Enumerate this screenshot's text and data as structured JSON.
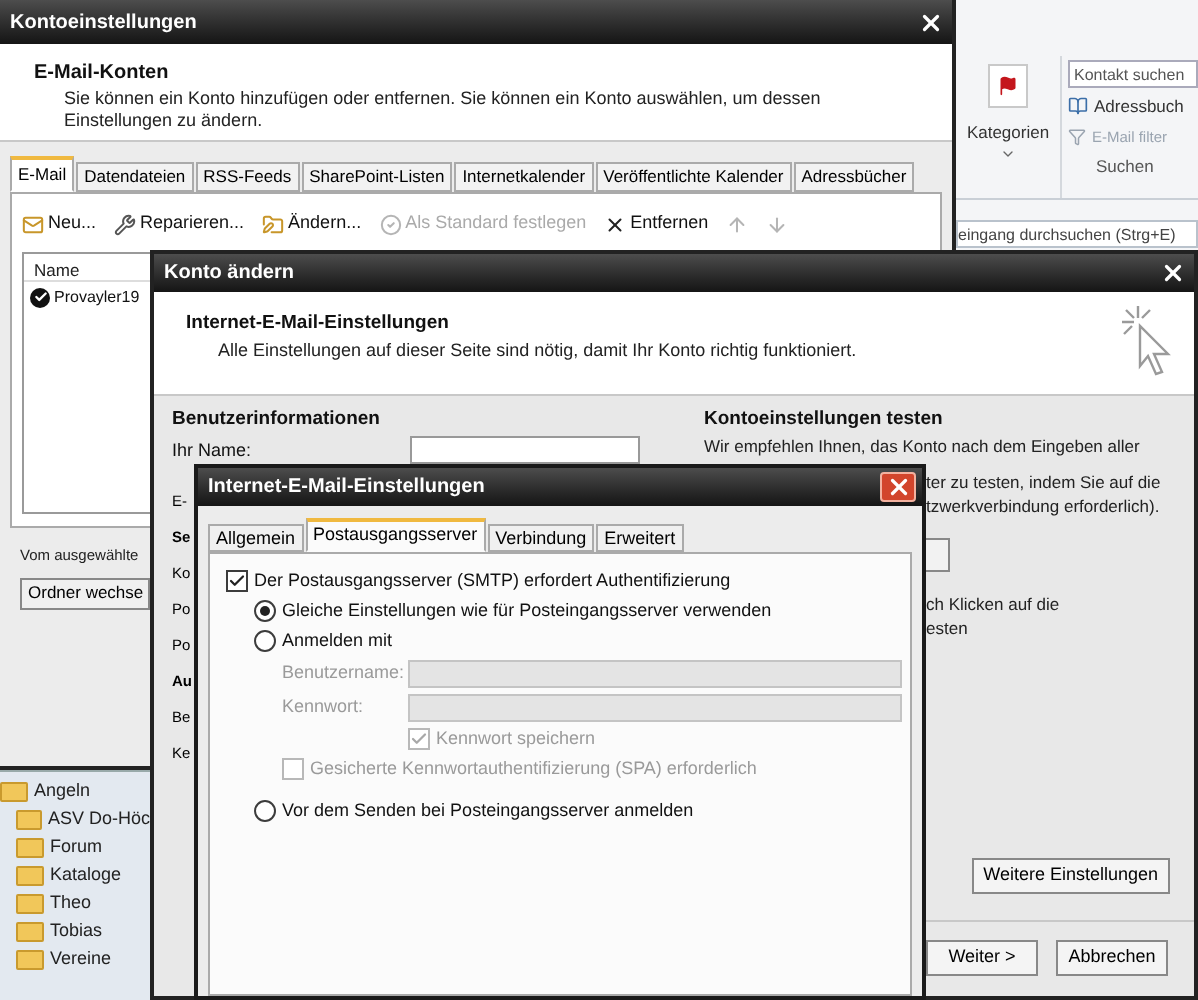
{
  "outlook": {
    "categories": {
      "label": "Kategorien"
    },
    "contact_search": {
      "placeholder": "Kontakt suchen"
    },
    "address_book": {
      "label": "Adressbuch",
      "disabled": false
    },
    "mail_filter": {
      "label": "E-Mail filter",
      "disabled": true
    },
    "group_label": "Suchen",
    "search_bar": {
      "placeholder": "eingang durchsuchen (Strg+E)"
    },
    "folders": [
      {
        "name": "Angeln",
        "children": [
          {
            "name": "ASV Do-Höc"
          },
          {
            "name": "Forum"
          },
          {
            "name": "Kataloge"
          },
          {
            "name": "Theo"
          },
          {
            "name": "Tobias"
          },
          {
            "name": "Vereine"
          }
        ]
      }
    ]
  },
  "account_settings": {
    "title": "Kontoeinstellungen",
    "heading": "E-Mail-Konten",
    "description": "Sie können ein Konto hinzufügen oder entfernen. Sie können ein Konto auswählen, um dessen Einstellungen zu ändern.",
    "tabs": [
      {
        "label": "E-Mail",
        "selected": true
      },
      {
        "label": "Datendateien",
        "selected": false
      },
      {
        "label": "RSS-Feeds",
        "selected": false
      },
      {
        "label": "SharePoint-Listen",
        "selected": false
      },
      {
        "label": "Internetkalender",
        "selected": false
      },
      {
        "label": "Veröffentlichte Kalender",
        "selected": false
      },
      {
        "label": "Adressbücher",
        "selected": false
      }
    ],
    "toolbar": [
      {
        "kind": "new",
        "label": "Neu...",
        "disabled": false
      },
      {
        "kind": "repair",
        "label": "Reparieren...",
        "disabled": false
      },
      {
        "kind": "change",
        "label": "Ändern...",
        "disabled": false
      },
      {
        "kind": "default",
        "label": "Als Standard festlegen",
        "disabled": true
      },
      {
        "kind": "remove",
        "label": "Entfernen",
        "disabled": false
      },
      {
        "kind": "up",
        "disabled": true
      },
      {
        "kind": "down",
        "disabled": true
      }
    ],
    "list": {
      "columns": [
        "Name"
      ],
      "rows": [
        {
          "name": "Provayler19",
          "default": true
        }
      ]
    },
    "folder_note": "Vom ausgewählte",
    "folder_button": "Ordner wechse"
  },
  "change_account": {
    "title": "Konto ändern",
    "heading": "Internet-E-Mail-Einstellungen",
    "description": "Alle Einstellungen auf dieser Seite sind nötig, damit Ihr Konto richtig funktioniert.",
    "user_heading": "Benutzerinformationen",
    "name_label": "Ihr Name:",
    "label_fragments": [
      {
        "kind": "label",
        "text": "E-"
      },
      {
        "kind": "heading",
        "text": "Se"
      },
      {
        "kind": "label",
        "text": "Ko"
      },
      {
        "kind": "label",
        "text": "Po"
      },
      {
        "kind": "label",
        "text": "Po"
      },
      {
        "kind": "heading",
        "text": "Au"
      },
      {
        "kind": "label",
        "text": "Be"
      },
      {
        "kind": "label",
        "text": "Ke"
      }
    ],
    "test_heading": "Kontoeinstellungen testen",
    "test_text": "Wir empfehlen Ihnen, das Konto nach dem Eingeben aller",
    "test_fragments": [
      {
        "kind": "text",
        "text": "ter zu testen, indem Sie auf die"
      },
      {
        "kind": "text",
        "text": "tzwerkverbindung erforderlich)."
      },
      {
        "kind": "button"
      },
      {
        "kind": "text",
        "text": "ch Klicken auf die"
      },
      {
        "kind": "text",
        "text": "esten"
      }
    ],
    "more_button": "Weitere Einstellungen",
    "buttons": [
      "Weiter >",
      "Abbrechen"
    ]
  },
  "email_settings": {
    "title": "Internet-E-Mail-Einstellungen",
    "tabs": [
      {
        "label": "Allgemein",
        "selected": false
      },
      {
        "label": "Postausgangsserver",
        "selected": true
      },
      {
        "label": "Verbindung",
        "selected": false
      },
      {
        "label": "Erweitert",
        "selected": false
      }
    ],
    "options": [
      {
        "kind": "checkbox",
        "label": "Der Postausgangsserver (SMTP) erfordert Authentifizierung",
        "checked": true,
        "disabled": false,
        "children": [
          {
            "kind": "radio",
            "label": "Gleiche Einstellungen wie für Posteingangsserver verwenden",
            "selected": true,
            "disabled": false
          },
          {
            "kind": "radio",
            "label": "Anmelden mit",
            "selected": false,
            "disabled": false,
            "children": [
              {
                "kind": "field",
                "label": "Benutzername:",
                "disabled": true
              },
              {
                "kind": "field",
                "label": "Kennwort:",
                "disabled": true
              },
              {
                "kind": "field_checkbox",
                "label": "Kennwort speichern",
                "checked": true,
                "disabled": true
              },
              {
                "kind": "checkbox",
                "label": "Gesicherte Kennwortauthentifizierung (SPA) erforderlich",
                "checked": false,
                "disabled": true
              }
            ]
          },
          {
            "kind": "radio",
            "label": "Vor dem Senden bei Posteingangsserver anmelden",
            "selected": false,
            "disabled": false
          }
        ]
      }
    ]
  }
}
